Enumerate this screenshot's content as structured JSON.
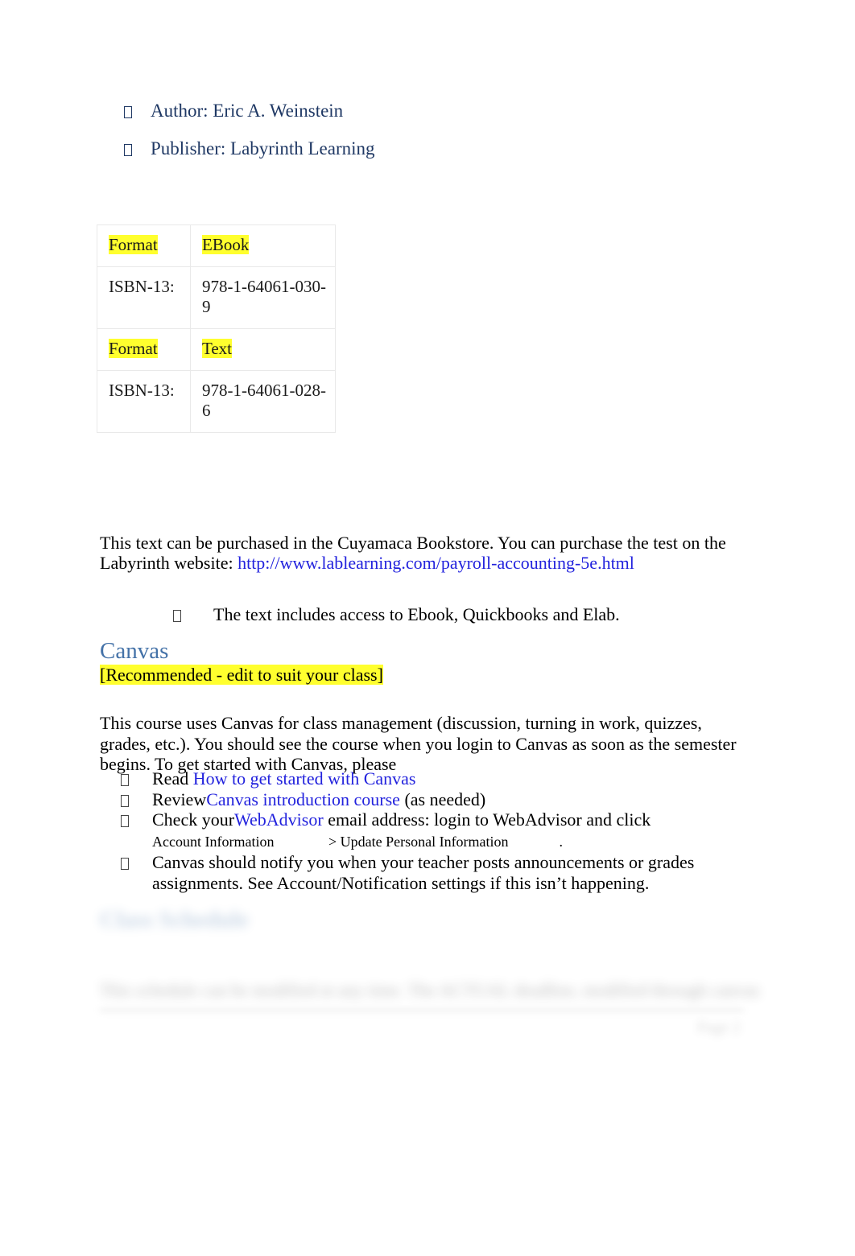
{
  "document": {
    "book_meta": {
      "items": [
        {
          "bullet": "tofu-bullet",
          "label": "Author:",
          "value": "Eric A. Weinstein",
          "line": "Author: Eric A. Weinstein"
        },
        {
          "bullet": "tofu-bullet",
          "label": "Publisher:",
          "value": "Labyrinth Learning",
          "line": "Publisher:  Labyrinth Learning"
        }
      ]
    },
    "isbn_table": {
      "rows": [
        {
          "label": "Format",
          "value": "EBook",
          "highlight": true
        },
        {
          "label": "ISBN-13:",
          "value": "978-1-64061-030-9",
          "highlight": false
        },
        {
          "label": "Format",
          "value": "Text",
          "highlight": true
        },
        {
          "label": "ISBN-13:",
          "value": "978-1-64061-028-6",
          "highlight": false
        }
      ]
    },
    "purchase": {
      "text_before": "This text can be purchased in the Cuyamaca Bookstore. You can purchase the test on the Labyrinth website: ",
      "url": "http://www.lablearning.com/payroll-accounting-5e.html"
    },
    "includes_bullet": {
      "text": "The text includes access to Ebook, Quickbooks and Elab."
    },
    "canvas_section": {
      "heading": "Canvas",
      "subnote": "[Recommended - edit to suit your class]",
      "paragraph": "This course uses Canvas for class management (discussion, turning in work, quizzes, grades, etc.).  You should see the course when you login to Canvas as soon as the semester begins.    To get started with Canvas, please",
      "steps": [
        {
          "prefix": "Read ",
          "link": "How to get started with Canvas",
          "suffix": "",
          "note": ""
        },
        {
          "prefix": "Review",
          "link": "Canvas introduction course",
          "suffix": " (as needed)",
          "note": ""
        },
        {
          "prefix": "Check your",
          "link": "WebAdvisor",
          "suffix": " email address:   login to WebAdvisor and click",
          "note_a": "Account Information",
          "note_b": "> Update Personal Information",
          "note_c": "."
        },
        {
          "prefix": "Canvas should notify you when your teacher posts announcements or grades assignments.    See Account/Notification settings if this isn’t happening.",
          "link": "",
          "suffix": "",
          "note": ""
        }
      ]
    },
    "blurred_section": {
      "heading": "Class Schedule",
      "paragraph": "This schedule can be modified at any time.   The ACTUAL deadline, modified through canvas",
      "corner": "Page 2"
    },
    "colors": {
      "navy_text": "#1f3864",
      "heading_blue": "#4472a8",
      "link_blue": "#2222dd",
      "highlight_yellow": "#ffff2e",
      "table_border": "#e9e9e9",
      "body_text": "#000000"
    }
  }
}
